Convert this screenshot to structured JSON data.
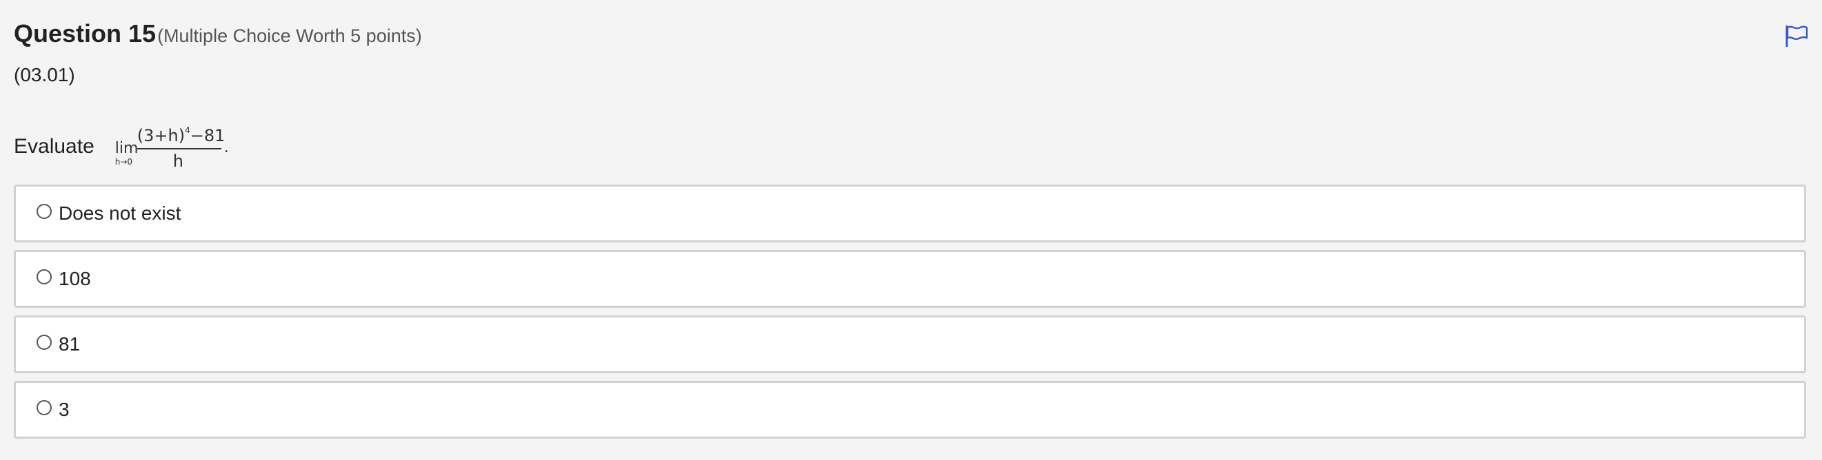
{
  "question": {
    "title": "Question 15",
    "meta": "(Multiple Choice Worth 5 points)",
    "code": "(03.01)",
    "prompt_word": "Evaluate",
    "formula": {
      "lim": "lim",
      "lim_sub": "h→0",
      "numerator_main": "(3+h)",
      "numerator_exp": "4",
      "numerator_tail": "−81",
      "denominator": "h",
      "period": "."
    }
  },
  "flag_icon": "flag-icon",
  "accent_color": "#3a5bbf",
  "options": [
    {
      "label": "Does not exist"
    },
    {
      "label": "108"
    },
    {
      "label": "81"
    },
    {
      "label": "3"
    }
  ]
}
